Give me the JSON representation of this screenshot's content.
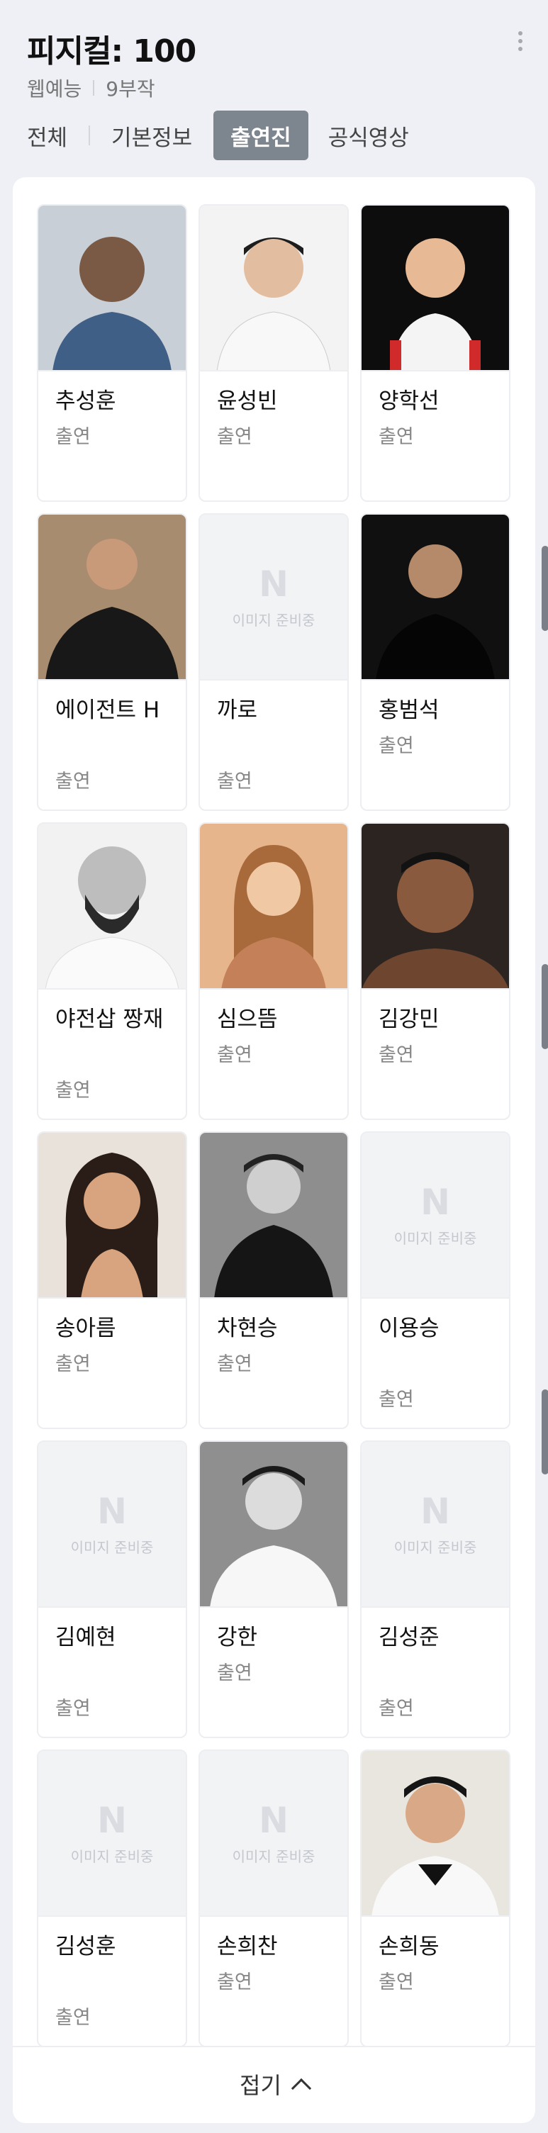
{
  "header": {
    "title": "피지컬: 100",
    "genre": "웹예능",
    "episodes": "9부작"
  },
  "tabs": [
    {
      "label": "전체"
    },
    {
      "label": "기본정보"
    },
    {
      "label": "출연진",
      "active": true
    },
    {
      "label": "공식영상"
    }
  ],
  "placeholder": {
    "logo": "N",
    "text": "이미지 준비중"
  },
  "cast": [
    {
      "name": "추성훈",
      "role": "출연"
    },
    {
      "name": "윤성빈",
      "role": "출연"
    },
    {
      "name": "양학선",
      "role": "출연"
    },
    {
      "name": "에이전트 H",
      "role": "출연"
    },
    {
      "name": "까로",
      "role": "출연"
    },
    {
      "name": "홍범석",
      "role": "출연"
    },
    {
      "name": "야전삽 짱재",
      "role": "출연"
    },
    {
      "name": "심으뜸",
      "role": "출연"
    },
    {
      "name": "김강민",
      "role": "출연"
    },
    {
      "name": "송아름",
      "role": "출연"
    },
    {
      "name": "차현승",
      "role": "출연"
    },
    {
      "name": "이용승",
      "role": "출연"
    },
    {
      "name": "김예현",
      "role": "출연"
    },
    {
      "name": "강한",
      "role": "출연"
    },
    {
      "name": "김성준",
      "role": "출연"
    },
    {
      "name": "김성훈",
      "role": "출연"
    },
    {
      "name": "손희찬",
      "role": "출연"
    },
    {
      "name": "손희동",
      "role": "출연"
    }
  ],
  "footer": {
    "fold_label": "접기"
  },
  "icons": [
    "more-vertical-icon",
    "chevron-up-icon",
    "naver-n-icon"
  ]
}
